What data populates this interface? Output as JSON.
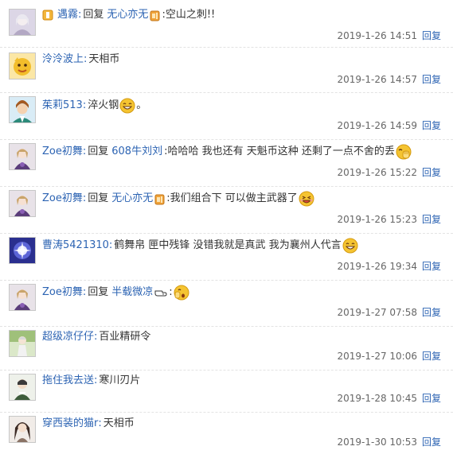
{
  "reply_label": "回复",
  "replies": [
    {
      "user": "遇霧",
      "colon": ":",
      "prefix": "回复",
      "target": "无心亦无",
      "text": ":空山之刺!!",
      "time": "2019-1-26 14:51",
      "action": "回复"
    },
    {
      "user": "泠泠波上",
      "colon": ":",
      "text": "天相币",
      "time": "2019-1-26 14:57",
      "action": "回复"
    },
    {
      "user": "茱莉513",
      "colon": ":",
      "text": "淬火钢",
      "after": "。",
      "time": "2019-1-26 14:59",
      "action": "回复"
    },
    {
      "user": "Zoe初舞",
      "colon": ":",
      "prefix": "回复",
      "target": "608牛刘刘",
      "text": ":哈哈哈 我也还有 天魁币这种 还剩了一点不舍的丢",
      "time": "2019-1-26 15:22",
      "action": "回复"
    },
    {
      "user": "Zoe初舞",
      "colon": ":",
      "prefix": "回复",
      "target": "无心亦无",
      "text": ":我们组合下 可以做主武器了",
      "time": "2019-1-26 15:23",
      "action": "回复"
    },
    {
      "user": "曹涛5421310",
      "colon": ":",
      "text": "鹤舞帛 匣中残锋 没错我就是真武 我为襄州人代言",
      "time": "2019-1-26 19:34",
      "action": "回复"
    },
    {
      "user": "Zoe初舞",
      "colon": ":",
      "prefix": "回复",
      "target": "半载微凉",
      "text": ":",
      "time": "2019-1-27 07:58",
      "action": "回复"
    },
    {
      "user": "超级凉仔仔",
      "colon": ":",
      "text": "百业精研令",
      "time": "2019-1-27 10:06",
      "action": "回复"
    },
    {
      "user": "拖住我去送",
      "colon": ":",
      "text": "寒川刃片",
      "time": "2019-1-28 10:45",
      "action": "回复"
    },
    {
      "user": "穿西装的猫r",
      "colon": ":",
      "text": "天相币",
      "time": "2019-1-30 10:53",
      "action": "回复"
    }
  ],
  "colors": {
    "link": "#2d64b3",
    "text": "#333333",
    "meta": "#666666",
    "emoji": "#f5c431"
  },
  "icons": [
    "vip-badge-icon",
    "tieba-badge-icon",
    "hand-point-icon",
    "smile-emoji-icon",
    "hand-cover-emoji-icon",
    "grin-emoji-icon",
    "hand-face-emoji-icon"
  ]
}
